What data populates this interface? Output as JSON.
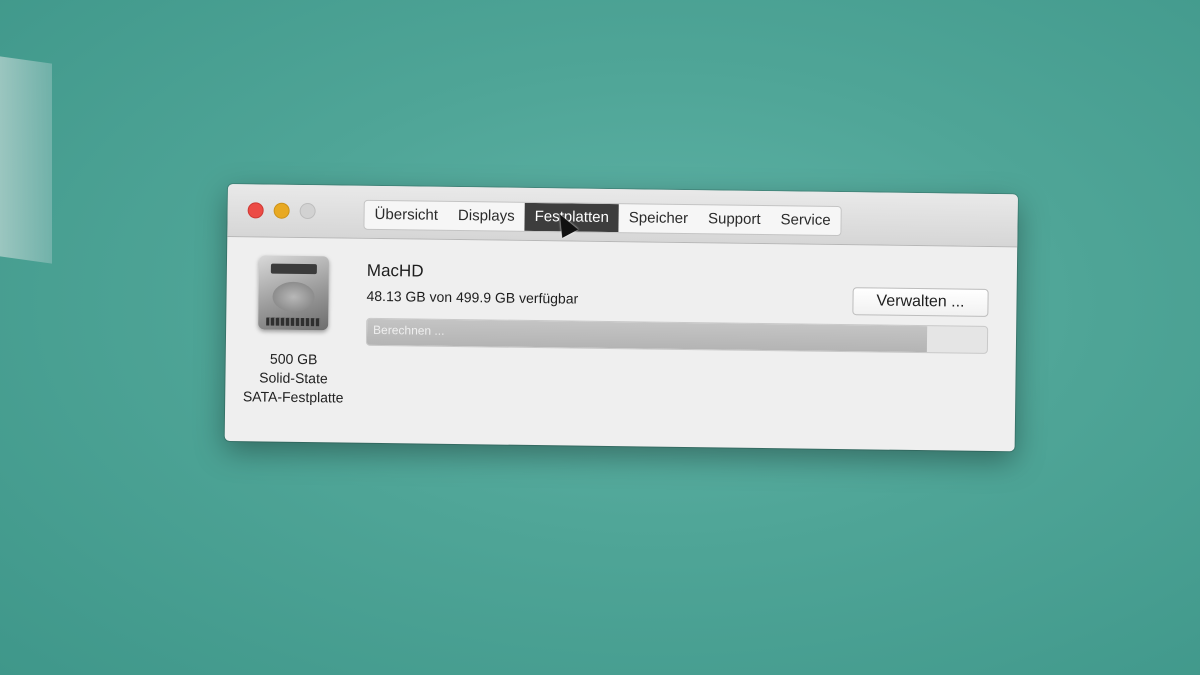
{
  "window": {
    "tabs": [
      {
        "label": "Übersicht"
      },
      {
        "label": "Displays"
      },
      {
        "label": "Festplatten",
        "active": true
      },
      {
        "label": "Speicher"
      },
      {
        "label": "Support"
      },
      {
        "label": "Service"
      }
    ]
  },
  "drive": {
    "capacity": "500 GB",
    "type": "Solid-State",
    "interface": "SATA-Festplatte"
  },
  "volume": {
    "name": "MacHD",
    "free_text": "48.13 GB von 499.9 GB verfügbar",
    "bar_label": "Berechnen ...",
    "used_fraction": 0.904
  },
  "actions": {
    "manage_label": "Verwalten ..."
  },
  "colors": {
    "desktop": "#4fa597",
    "close": "#ec4b45",
    "minimize": "#e8a922",
    "active_tab": "#3d3d3d"
  }
}
